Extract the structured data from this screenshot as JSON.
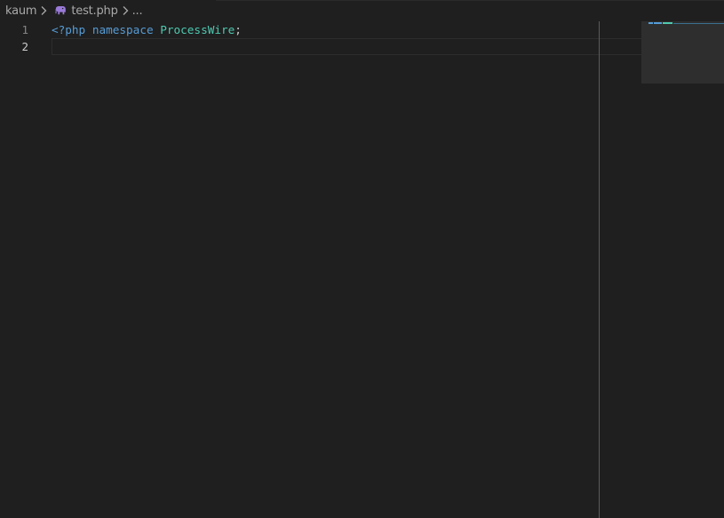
{
  "breadcrumbs": [
    {
      "label": "kaum"
    },
    {
      "label": "test.php",
      "icon": "php-elephant-icon"
    },
    {
      "label": "..."
    }
  ],
  "colors": {
    "background": "#1f1f1f",
    "php_tag": "#569cd6",
    "keyword": "#569cd6",
    "namespace": "#4ec9b0",
    "punctuation": "#cccccc",
    "line_number": "#858585",
    "php_icon": "#9a7ad8"
  },
  "editor": {
    "line_numbers": [
      "1",
      "2"
    ],
    "lines": [
      {
        "tokens": [
          {
            "type": "php-tag",
            "text": "<?php"
          },
          {
            "type": "space",
            "text": " "
          },
          {
            "type": "keyword",
            "text": "namespace"
          },
          {
            "type": "space",
            "text": " "
          },
          {
            "type": "namespace",
            "text": "ProcessWire"
          },
          {
            "type": "punctuation",
            "text": ";"
          }
        ]
      },
      {
        "tokens": []
      }
    ],
    "active_line": 2
  }
}
